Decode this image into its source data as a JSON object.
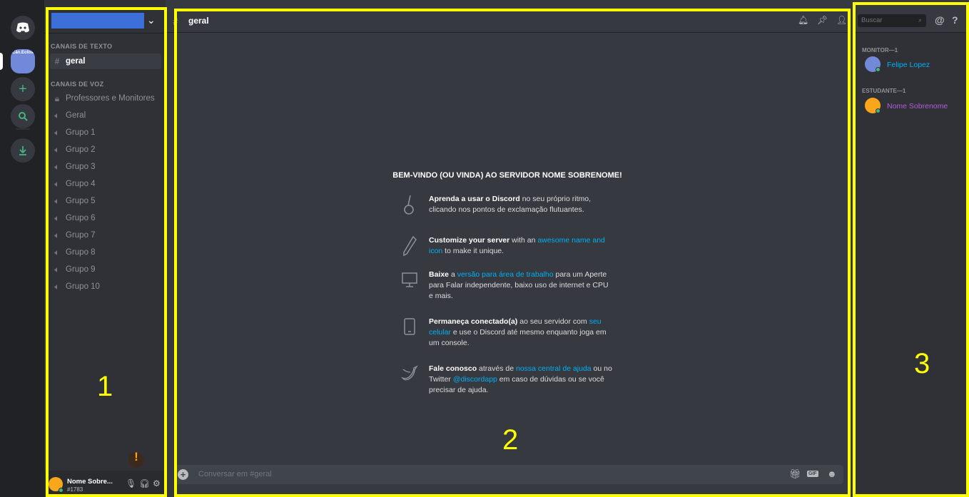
{
  "rail": {
    "server_label": "Cân.Eclixel.D"
  },
  "guild": {
    "chevron": "⌄"
  },
  "channels": {
    "text_category": "CANAIS DE TEXTO",
    "text_channels": [
      {
        "label": "geral"
      }
    ],
    "voice_category": "CANAIS DE VOZ",
    "locked_channel": "Professores e Monitores",
    "voice_channels": [
      "Geral",
      "Grupo 1",
      "Grupo 2",
      "Grupo 3",
      "Grupo 4",
      "Grupo 5",
      "Grupo 6",
      "Grupo 7",
      "Grupo 8",
      "Grupo 9",
      "Grupo 10"
    ]
  },
  "user": {
    "name": "Nome Sobre...",
    "tag": "#1783",
    "status_color": "#43b581"
  },
  "main": {
    "channel_title": "geral",
    "welcome_title": "BEM-VINDO (OU VINDA) AO SERVIDOR NOME SOBRENOME!",
    "composer_placeholder": "Conversar em #geral",
    "gif_label": "GIF"
  },
  "tips": [
    {
      "icon": "exclamation-icon",
      "bold": "Aprenda a usar o Discord",
      "t1": " no seu próprio ritmo, clicando nos pontos de exclamação flutuantes.",
      "link": "",
      "t2": ""
    },
    {
      "icon": "pencil-icon",
      "bold": "Customize your server",
      "t1": " with an ",
      "link": "awesome name and icon",
      "t2": " to make it unique."
    },
    {
      "icon": "monitor-icon",
      "bold": "Baixe",
      "t1": " a ",
      "link": "versão para área de trabalho",
      "t2": " para um Aperte para Falar independente, baixo uso de internet e CPU e mais."
    },
    {
      "icon": "phone-icon",
      "bold": "Permaneça conectado(a)",
      "t1": " ao seu servidor com ",
      "link": "seu celular",
      "t2": " e use o Discord até mesmo enquanto joga em um console."
    },
    {
      "icon": "twitter-icon",
      "bold": "Fale conosco",
      "t1": " através de ",
      "link": "nossa central de ajuda",
      "t2": " ou no Twitter ",
      "link2": "@discordapp",
      "t3": " em caso de dúvidas ou se você precisar de ajuda."
    }
  ],
  "members": {
    "search_placeholder": "Buscar",
    "groups": [
      {
        "role": "MONITOR—1",
        "name": "Felipe Lopez",
        "color": "#00b0f4",
        "avatar": "#7289da"
      },
      {
        "role": "ESTUDANTE—1",
        "name": "Nome Sobrenome",
        "color": "#b45ddb",
        "avatar": "#faa61a"
      }
    ]
  },
  "annotations": {
    "labels": [
      "1",
      "2",
      "3"
    ],
    "color": "#ffff00"
  }
}
